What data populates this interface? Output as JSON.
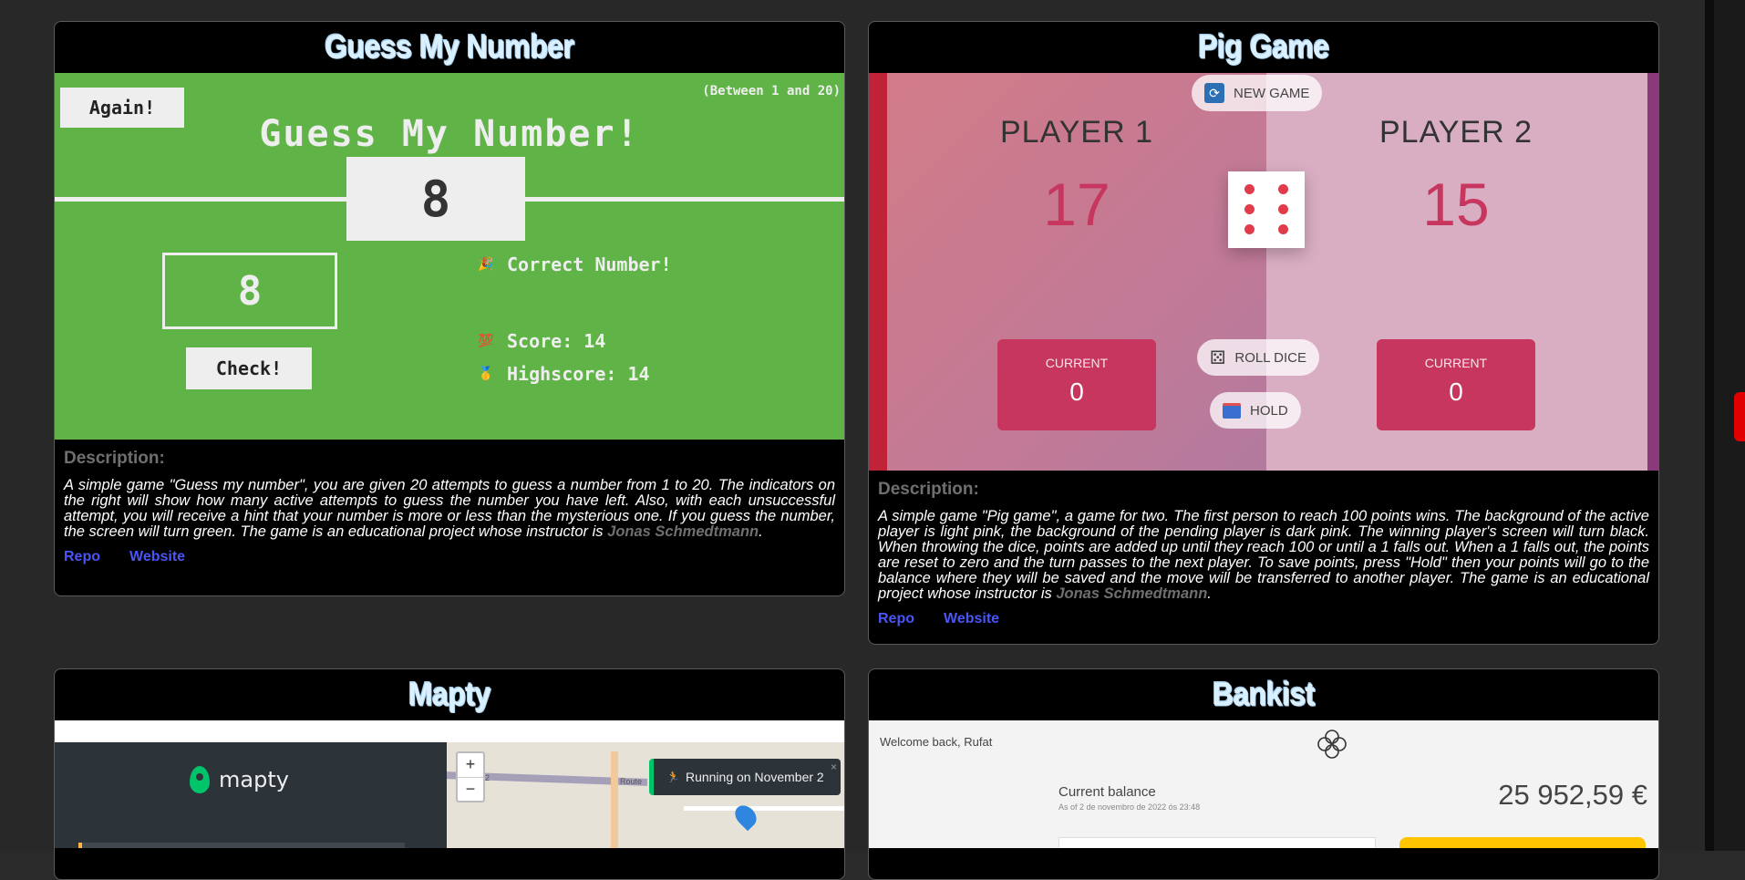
{
  "projects": [
    {
      "title": "Guess My Number",
      "demo": {
        "again_label": "Again!",
        "range_label": "(Between 1 and 20)",
        "heading": "Guess My Number!",
        "secret_number": "8",
        "guess_value": "8",
        "check_label": "Check!",
        "message": "Correct Number!",
        "message_icon": "🎉",
        "score_label": "Score: 14",
        "score_icon": "💯",
        "highscore_label": "Highscore: 14",
        "highscore_icon": "🥇"
      },
      "description_heading": "Description:",
      "description": "A simple game \"Guess my number\", you are given 20 attempts to guess a number from 1 to 20. The indicators on the right will show how many active attempts to guess the number you have left. Also, with each unsuccessful attempt, you will receive a hint that your number is more or less than the mysterious one. If you guess the number, the screen will turn green. The game is an educational project whose instructor is ",
      "instructor": "Jonas Schmedtmann",
      "period": ".",
      "links": {
        "repo": "Repo",
        "website": "Website"
      }
    },
    {
      "title": "Pig Game",
      "demo": {
        "new_game_label": "NEW GAME",
        "player1_name": "PLAYER 1",
        "player1_score": "17",
        "player2_name": "PLAYER 2",
        "player2_score": "15",
        "current_label": "CURRENT",
        "player1_current": "0",
        "player2_current": "0",
        "roll_label": "ROLL DICE",
        "hold_label": "HOLD",
        "dice_value": 6
      },
      "description_heading": "Description:",
      "description": "A simple game \"Pig game\", a game for two. The first person to reach 100 points wins. The background of the active player is light pink, the background of the pending player is dark pink. The winning player's screen will turn black. When throwing the dice, points are added up until they reach 100 or until a 1 falls out. When a 1 falls out, the points are reset to zero and the turn passes to the next player. To save points, press \"Hold\" then your points will go to the balance where they will be saved and the move will be transferred to another player. The game is an educational project whose instructor is ",
      "instructor": "Jonas Schmedtmann",
      "period": ".",
      "links": {
        "repo": "Repo",
        "website": "Website"
      }
    },
    {
      "title": "Mapty",
      "demo": {
        "logo_text": "mapty",
        "zoom_in": "+",
        "zoom_out": "−",
        "popup_icon": "🏃",
        "popup_text": "Running on November 2",
        "popup_close": "×",
        "map_label_route": "Route",
        "map_label_number": "2"
      }
    },
    {
      "title": "Bankist",
      "demo": {
        "welcome": "Welcome back, Rufat",
        "current_balance_label": "Current balance",
        "as_of": "As of 2 de novembro de 2022 ós 23:48",
        "balance": "25 952,59 €"
      }
    }
  ],
  "colors": {
    "page_bg": "#282828",
    "card_bg": "#000000",
    "guess_green": "#60b347",
    "pig_accent": "#c7365f",
    "link_blue": "#4a55f5",
    "scroll_thumb": "#e00000"
  }
}
